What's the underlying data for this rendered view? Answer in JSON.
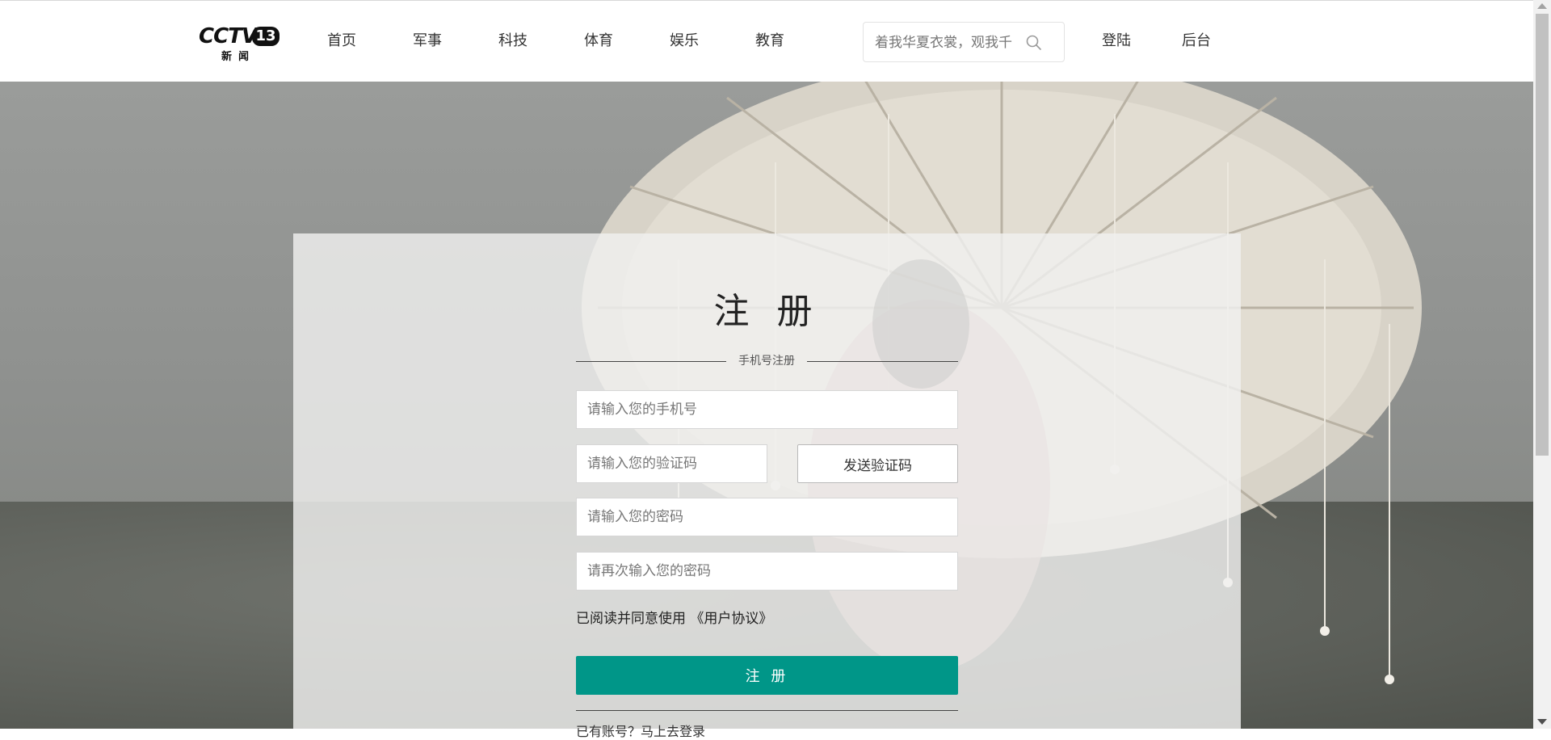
{
  "header": {
    "logo": {
      "wordmark": "CCTV",
      "channel": "13",
      "sub": "新闻"
    },
    "nav": [
      "首页",
      "军事",
      "科技",
      "体育",
      "娱乐",
      "教育"
    ],
    "search": {
      "placeholder": "着我华夏衣裳，观我千",
      "icon": "search-icon"
    },
    "login": "登陆",
    "admin": "后台"
  },
  "register": {
    "title": "注 册",
    "subtitle": "手机号注册",
    "phone_placeholder": "请输入您的手机号",
    "code_placeholder": "请输入您的验证码",
    "send_code": "发送验证码",
    "password_placeholder": "请输入您的密码",
    "confirm_placeholder": "请再次输入您的密码",
    "agree_text": "已阅读并同意使用",
    "agreement_link": "《用户协议》",
    "submit": "注 册",
    "login_hint": "已有账号？马上去登录"
  },
  "colors": {
    "accent": "#009688"
  }
}
